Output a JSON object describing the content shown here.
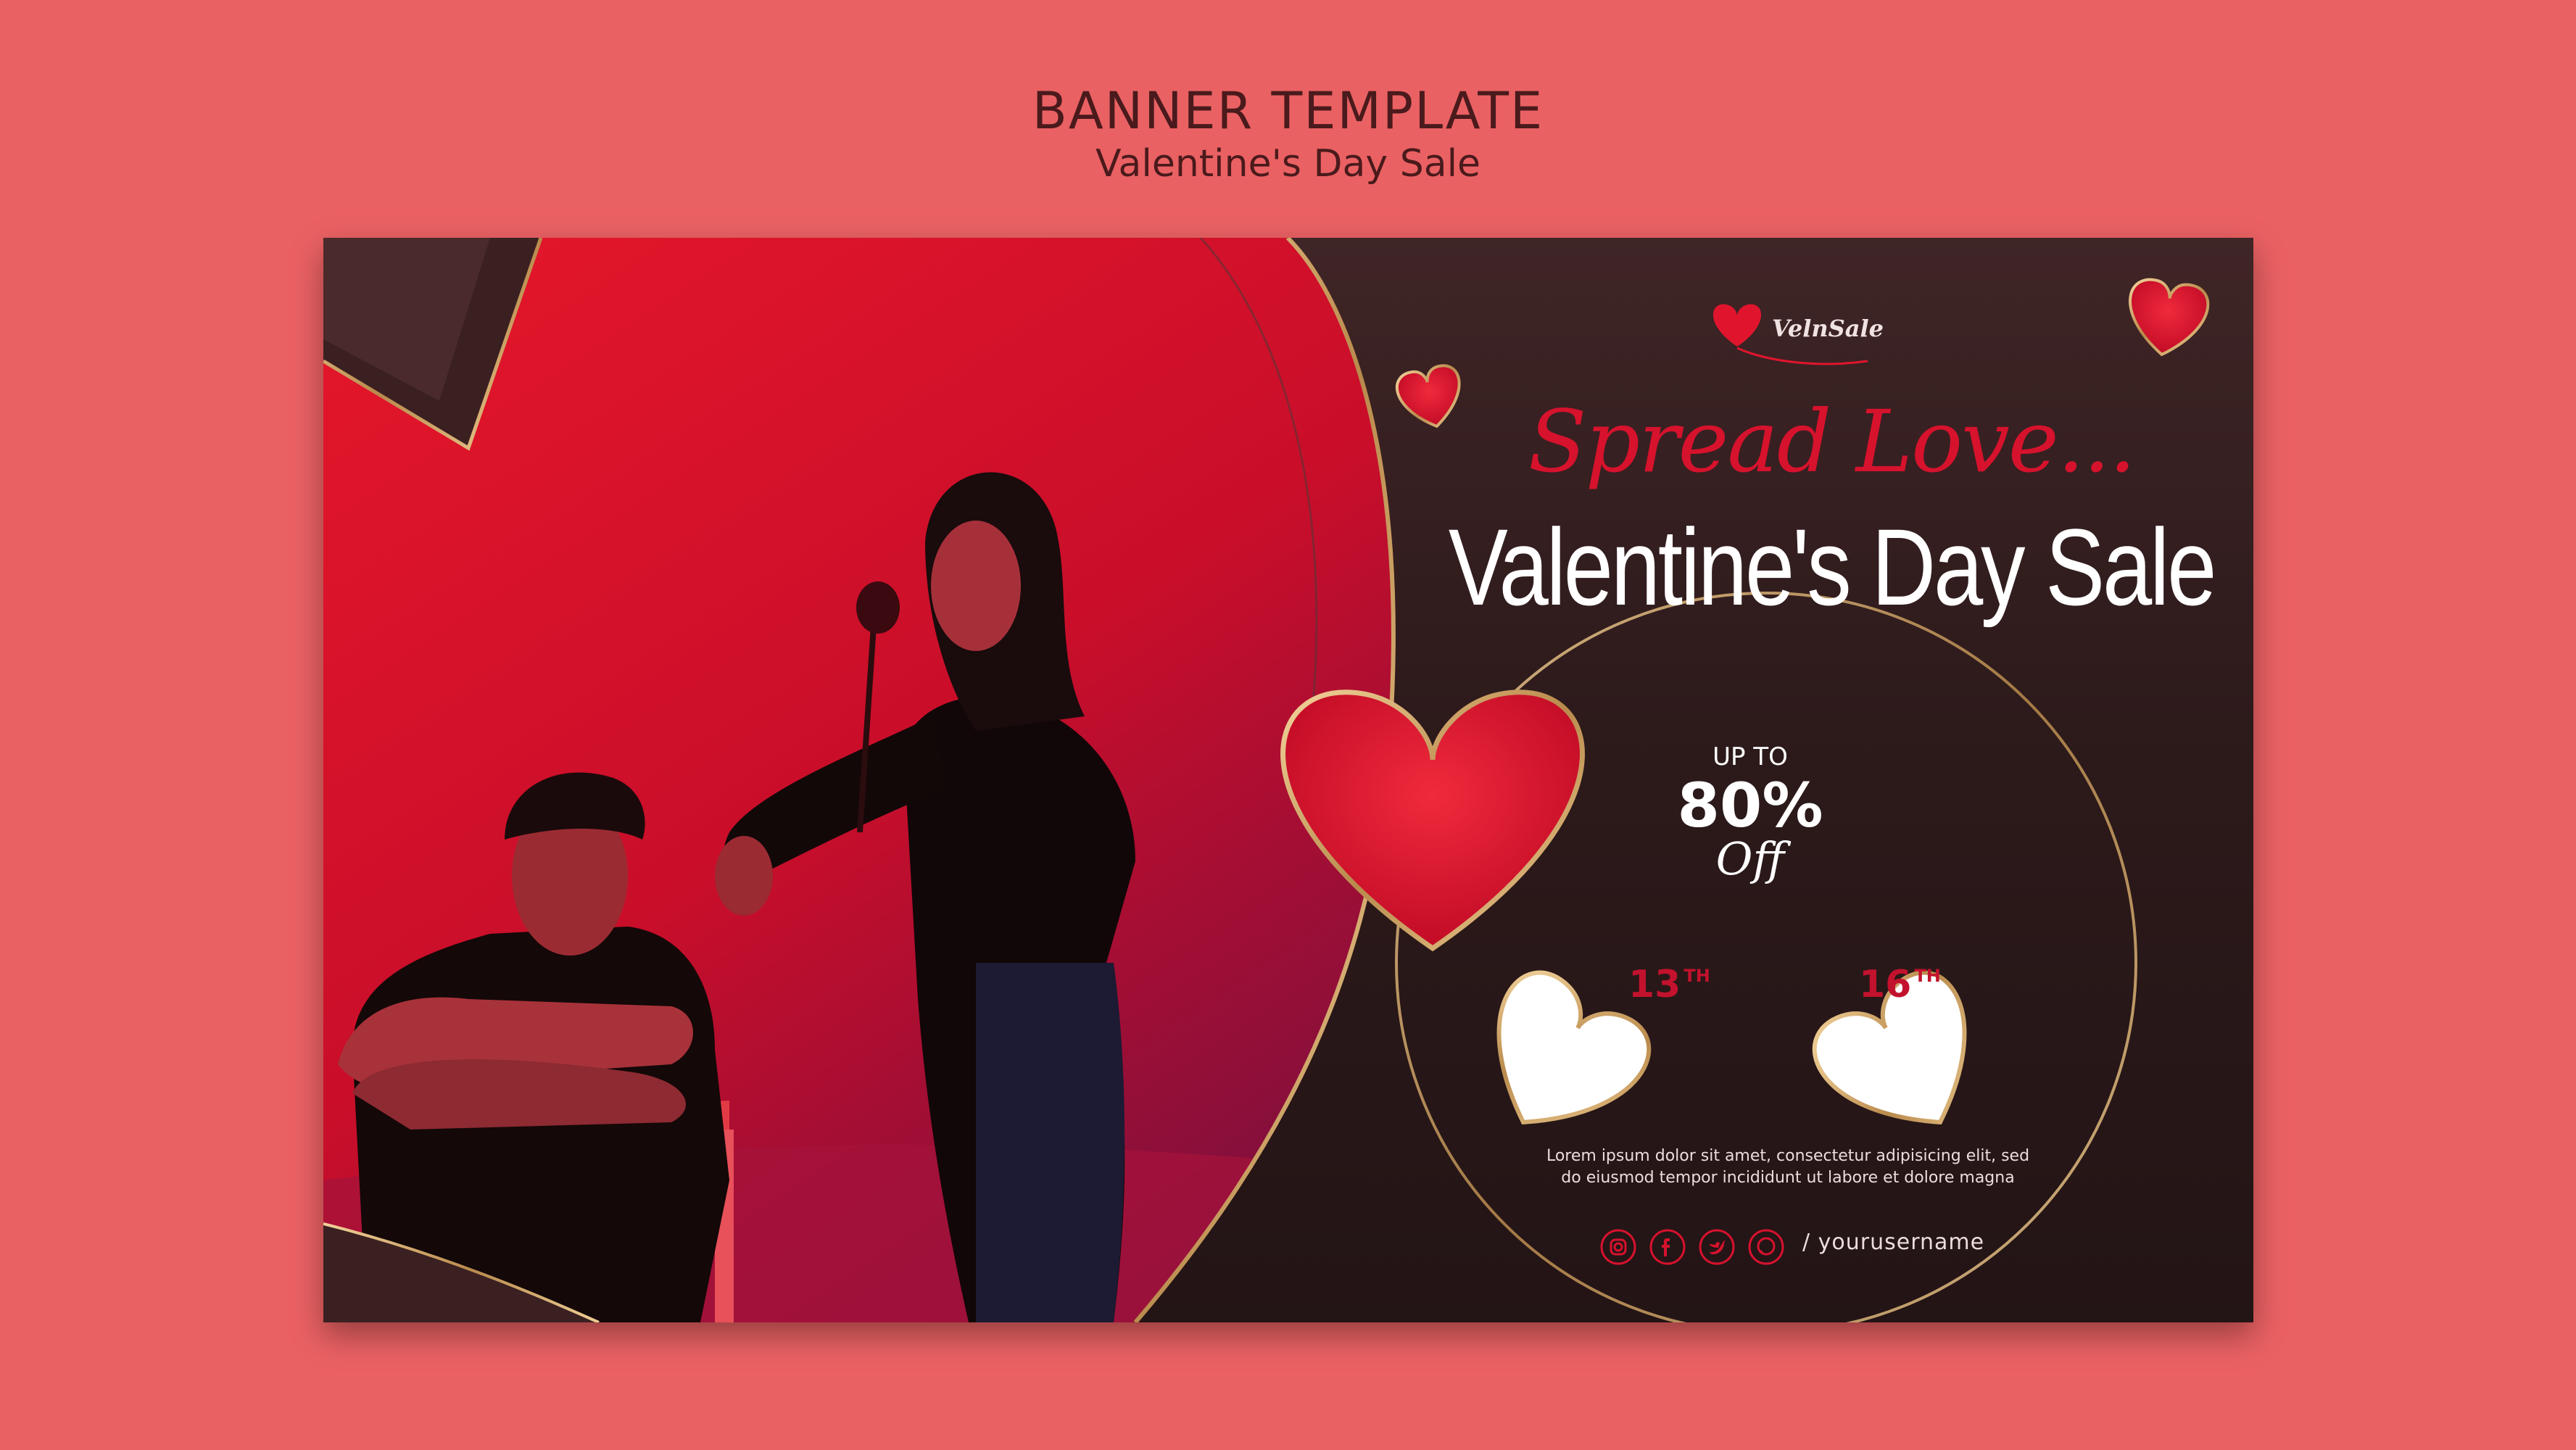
{
  "page": {
    "title": "BANNER TEMPLATE",
    "subtitle": "Valentine's Day Sale"
  },
  "banner": {
    "brand": "VelnSale",
    "tagline": "Spread Love...",
    "headline": "Valentine's Day Sale",
    "offer": {
      "prefix": "UP TO",
      "value": "80%",
      "suffix": "Off"
    },
    "dates": [
      {
        "day": "13",
        "suffix": "TH"
      },
      {
        "day": "16",
        "suffix": "TH"
      }
    ],
    "description_line1": "Lorem ipsum dolor sit amet, consectetur adipisicing elit, sed",
    "description_line2": "do eiusmod tempor incididunt ut labore et dolore magna",
    "social_icons": [
      "instagram-icon",
      "facebook-icon",
      "twitter-icon",
      "whatsapp-icon"
    ],
    "username": "/ yourusername"
  },
  "colors": {
    "background": "#ea6163",
    "banner_dark": "#2d1a1b",
    "accent_red": "#d6122d",
    "gold": "#c9a06a"
  }
}
